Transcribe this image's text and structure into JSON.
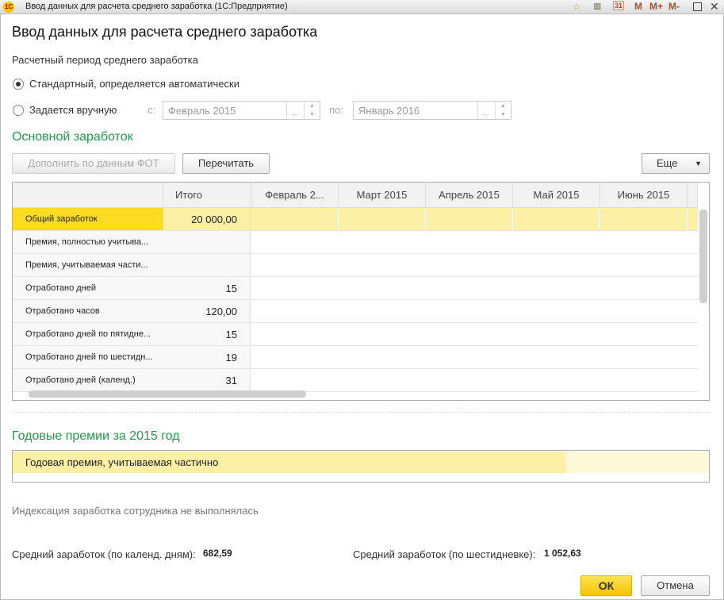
{
  "window": {
    "title": "Ввод данных для расчета среднего заработка  (1С:Предприятие)",
    "logo": "1С",
    "toolbar": [
      "M",
      "M+",
      "M-"
    ]
  },
  "header": {
    "title": "Ввод данных для расчета среднего заработка"
  },
  "period": {
    "label": "Расчетный период среднего заработка",
    "option_auto": "Стандартный, определяется автоматически",
    "option_manual": "Задается вручную",
    "from_label": "с:",
    "from_value": "Февраль 2015",
    "to_label": "по:",
    "to_value": "Январь 2016",
    "selected": "auto"
  },
  "main": {
    "section_title": "Основной заработок",
    "fill_button": "Дополнить по данным ФОТ",
    "reread_button": "Перечитать",
    "more_button": "Еще",
    "columns": [
      "",
      "Итого",
      "Февраль 2...",
      "Март 2015",
      "Апрель 2015",
      "Май 2015",
      "Июнь 2015"
    ],
    "rows": [
      {
        "name": "Общий заработок",
        "total": "20 000,00"
      },
      {
        "name": "Премия, полностью учитыва...",
        "total": ""
      },
      {
        "name": "Премия, учитываемая части...",
        "total": ""
      },
      {
        "name": "Отработано дней",
        "total": "15"
      },
      {
        "name": "Отработано часов",
        "total": "120,00"
      },
      {
        "name": "Отработано дней по пятидне...",
        "total": "15"
      },
      {
        "name": "Отработано дней по шестидн...",
        "total": "19"
      },
      {
        "name": "Отработано дней (календ.)",
        "total": "31"
      }
    ]
  },
  "bonuses": {
    "section_title": "Годовые премии за 2015 год",
    "row": "Годовая премия, учитываемая частично"
  },
  "indexation_note": "Индексация заработка сотрудника не выполнялась",
  "averages": {
    "calendar_label": "Средний заработок (по календ. дням):",
    "calendar_value": "682,59",
    "sixday_label": "Средний заработок (по шестидневке):",
    "sixday_value": "1 052,63"
  },
  "footer": {
    "ok": "ОК",
    "cancel": "Отмена"
  }
}
